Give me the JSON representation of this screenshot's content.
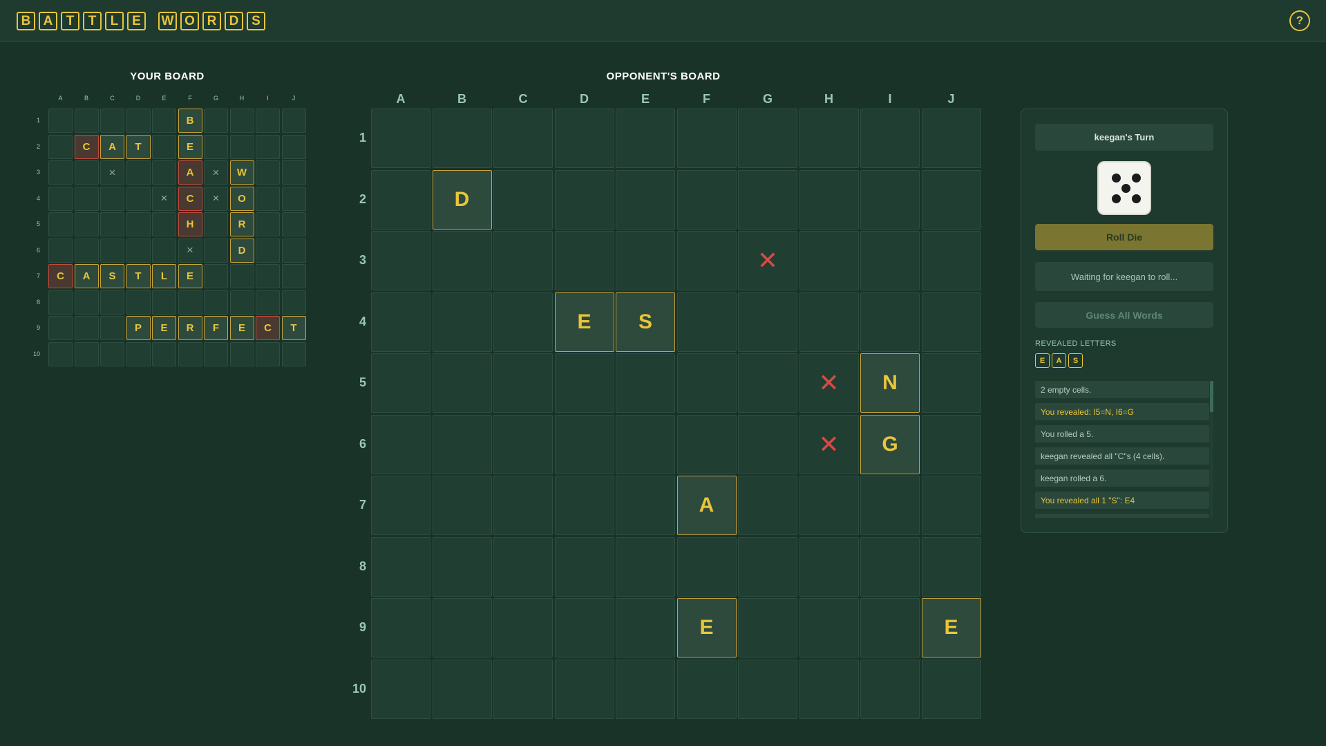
{
  "logo": {
    "word1": [
      "B",
      "A",
      "T",
      "T",
      "L",
      "E"
    ],
    "word2": [
      "W",
      "O",
      "R",
      "D",
      "S"
    ]
  },
  "help_label": "?",
  "your_board": {
    "title": "YOUR BOARD",
    "columns": [
      "A",
      "B",
      "C",
      "D",
      "E",
      "F",
      "G",
      "H",
      "I",
      "J"
    ],
    "rows": [
      "1",
      "2",
      "3",
      "4",
      "5",
      "6",
      "7",
      "8",
      "9",
      "10"
    ],
    "cells": [
      {
        "r": 1,
        "c": 6,
        "t": "B",
        "s": "letter"
      },
      {
        "r": 2,
        "c": 2,
        "t": "C",
        "s": "hit"
      },
      {
        "r": 2,
        "c": 3,
        "t": "A",
        "s": "letter"
      },
      {
        "r": 2,
        "c": 4,
        "t": "T",
        "s": "letter"
      },
      {
        "r": 2,
        "c": 6,
        "t": "E",
        "s": "letter"
      },
      {
        "r": 3,
        "c": 3,
        "t": "×",
        "s": "miss"
      },
      {
        "r": 3,
        "c": 6,
        "t": "A",
        "s": "hit"
      },
      {
        "r": 3,
        "c": 7,
        "t": "×",
        "s": "miss"
      },
      {
        "r": 3,
        "c": 8,
        "t": "W",
        "s": "letter"
      },
      {
        "r": 4,
        "c": 5,
        "t": "×",
        "s": "miss"
      },
      {
        "r": 4,
        "c": 6,
        "t": "C",
        "s": "hit"
      },
      {
        "r": 4,
        "c": 7,
        "t": "×",
        "s": "miss"
      },
      {
        "r": 4,
        "c": 8,
        "t": "O",
        "s": "letter"
      },
      {
        "r": 5,
        "c": 6,
        "t": "H",
        "s": "hit"
      },
      {
        "r": 5,
        "c": 8,
        "t": "R",
        "s": "letter"
      },
      {
        "r": 6,
        "c": 6,
        "t": "×",
        "s": "miss"
      },
      {
        "r": 6,
        "c": 8,
        "t": "D",
        "s": "letter"
      },
      {
        "r": 7,
        "c": 1,
        "t": "C",
        "s": "hit"
      },
      {
        "r": 7,
        "c": 2,
        "t": "A",
        "s": "letter"
      },
      {
        "r": 7,
        "c": 3,
        "t": "S",
        "s": "letter"
      },
      {
        "r": 7,
        "c": 4,
        "t": "T",
        "s": "letter"
      },
      {
        "r": 7,
        "c": 5,
        "t": "L",
        "s": "letter"
      },
      {
        "r": 7,
        "c": 6,
        "t": "E",
        "s": "letter"
      },
      {
        "r": 9,
        "c": 4,
        "t": "P",
        "s": "letter"
      },
      {
        "r": 9,
        "c": 5,
        "t": "E",
        "s": "letter"
      },
      {
        "r": 9,
        "c": 6,
        "t": "R",
        "s": "letter"
      },
      {
        "r": 9,
        "c": 7,
        "t": "F",
        "s": "letter"
      },
      {
        "r": 9,
        "c": 8,
        "t": "E",
        "s": "letter"
      },
      {
        "r": 9,
        "c": 9,
        "t": "C",
        "s": "hit"
      },
      {
        "r": 9,
        "c": 10,
        "t": "T",
        "s": "letter"
      }
    ]
  },
  "opponent_board": {
    "title": "OPPONENT'S BOARD",
    "columns": [
      "A",
      "B",
      "C",
      "D",
      "E",
      "F",
      "G",
      "H",
      "I",
      "J"
    ],
    "rows": [
      "1",
      "2",
      "3",
      "4",
      "5",
      "6",
      "7",
      "8",
      "9",
      "10"
    ],
    "cells": [
      {
        "r": 2,
        "c": 2,
        "t": "D",
        "s": "letter"
      },
      {
        "r": 3,
        "c": 7,
        "t": "✕",
        "s": "miss"
      },
      {
        "r": 4,
        "c": 4,
        "t": "E",
        "s": "letter"
      },
      {
        "r": 4,
        "c": 5,
        "t": "S",
        "s": "letter"
      },
      {
        "r": 5,
        "c": 8,
        "t": "✕",
        "s": "miss"
      },
      {
        "r": 5,
        "c": 9,
        "t": "N",
        "s": "letter"
      },
      {
        "r": 6,
        "c": 8,
        "t": "✕",
        "s": "miss"
      },
      {
        "r": 6,
        "c": 9,
        "t": "G",
        "s": "letter"
      },
      {
        "r": 7,
        "c": 6,
        "t": "A",
        "s": "letter"
      },
      {
        "r": 9,
        "c": 6,
        "t": "E",
        "s": "letter"
      },
      {
        "r": 9,
        "c": 10,
        "t": "E",
        "s": "letter"
      }
    ]
  },
  "panel": {
    "turn_label": "keegan's Turn",
    "die_value": 5,
    "roll_button": "Roll Die",
    "status_text": "Waiting for keegan to roll...",
    "guess_button": "Guess All Words",
    "revealed_label": "REVEALED LETTERS",
    "revealed_letters": [
      "E",
      "A",
      "S"
    ],
    "log": [
      {
        "text": "2 empty cells.",
        "highlight": false
      },
      {
        "text": "You revealed: I5=N, I6=G",
        "highlight": true
      },
      {
        "text": "You rolled a 5.",
        "highlight": false
      },
      {
        "text": "keegan revealed all \"C\"s (4 cells).",
        "highlight": false
      },
      {
        "text": "keegan rolled a 6.",
        "highlight": false
      },
      {
        "text": "You revealed all 1 \"S\": E4",
        "highlight": true
      },
      {
        "text": "",
        "highlight": false
      }
    ]
  },
  "colors": {
    "background": "#1a3329",
    "accent": "#e9c53a",
    "hit_border": "#c54a3e",
    "miss_mark": "#d94a43"
  }
}
